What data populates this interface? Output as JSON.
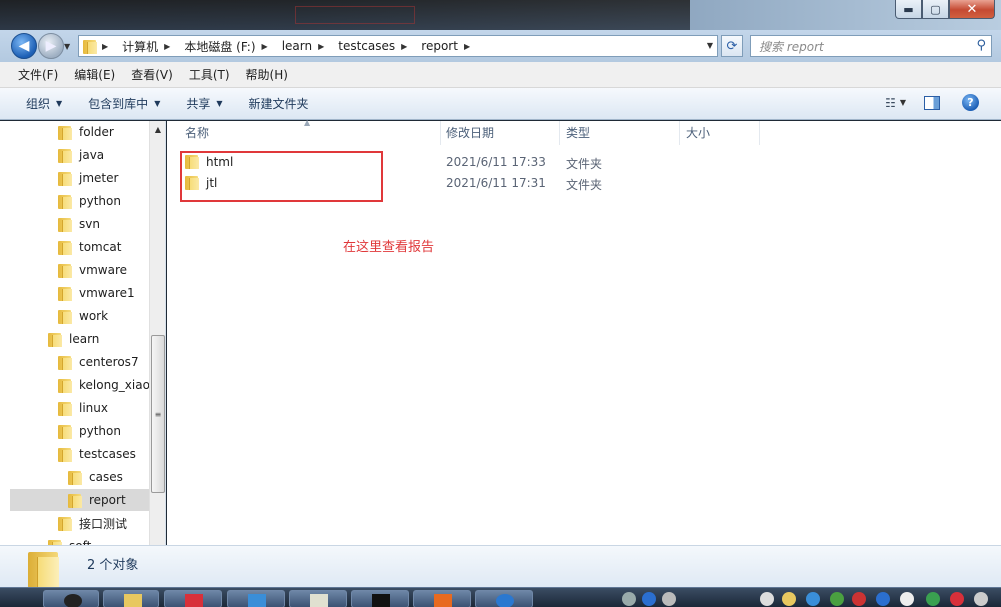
{
  "window": {
    "minimize": "▬",
    "maximize": "▢",
    "close": "✕"
  },
  "address": {
    "breadcrumbs": [
      "计算机",
      "本地磁盘 (F:)",
      "learn",
      "testcases",
      "report"
    ],
    "search_placeholder": "搜索 report"
  },
  "menu": [
    "文件(F)",
    "编辑(E)",
    "查看(V)",
    "工具(T)",
    "帮助(H)"
  ],
  "toolbar": {
    "organize": "组织",
    "include_in_library": "包含到库中",
    "share": "共享",
    "new_folder": "新建文件夹"
  },
  "nav_tree": [
    {
      "label": "folder",
      "indent": 2
    },
    {
      "label": "java",
      "indent": 2
    },
    {
      "label": "jmeter",
      "indent": 2
    },
    {
      "label": "python",
      "indent": 2
    },
    {
      "label": "svn",
      "indent": 2
    },
    {
      "label": "tomcat",
      "indent": 2
    },
    {
      "label": "vmware",
      "indent": 2
    },
    {
      "label": "vmware1",
      "indent": 2
    },
    {
      "label": "work",
      "indent": 2
    },
    {
      "label": "learn",
      "indent": 1
    },
    {
      "label": "centeros7",
      "indent": 2
    },
    {
      "label": "kelong_xiao",
      "indent": 2
    },
    {
      "label": "linux",
      "indent": 2
    },
    {
      "label": "python",
      "indent": 2
    },
    {
      "label": "testcases",
      "indent": 2
    },
    {
      "label": "cases",
      "indent": 3
    },
    {
      "label": "report",
      "indent": 3,
      "selected": true
    },
    {
      "label": "接口测试",
      "indent": 2
    },
    {
      "label": "soft",
      "indent": 1
    }
  ],
  "columns": {
    "name": "名称",
    "date": "修改日期",
    "type": "类型",
    "size": "大小"
  },
  "files": [
    {
      "name": "html",
      "date": "2021/6/11 17:33",
      "type": "文件夹"
    },
    {
      "name": "jtl",
      "date": "2021/6/11 17:31",
      "type": "文件夹"
    }
  ],
  "annotation": "在这里查看报告",
  "details": {
    "count": "2 个对象"
  },
  "colors": {
    "accent_red": "#e0383a",
    "toolbar_text": "#1e395b"
  }
}
